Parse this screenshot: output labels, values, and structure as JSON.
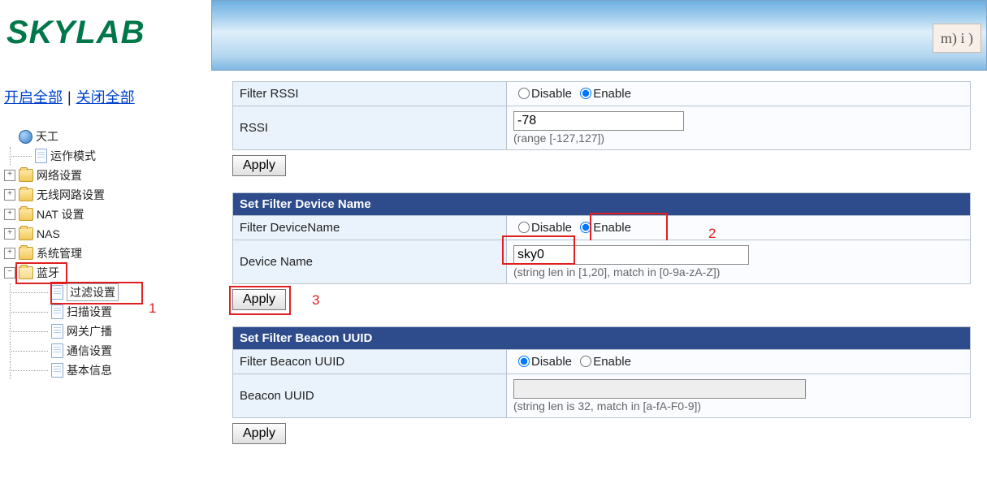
{
  "brand": "SKYLAB",
  "bannerIcon": "m) i )",
  "links": {
    "openAll": "开启全部",
    "closeAll": "关闭全部"
  },
  "tree": {
    "root": "天工",
    "items": {
      "opMode": "运作模式",
      "network": "网络设置",
      "wireless": "无线网路设置",
      "nat": "NAT 设置",
      "nas": "NAS",
      "sysMgmt": "系统管理",
      "bluetooth": "蓝牙",
      "btFilter": "过滤设置",
      "btScan": "扫描设置",
      "btGateway": "网关广播",
      "btComm": "通信设置",
      "btInfo": "基本信息"
    }
  },
  "rssi": {
    "filterLabel": "Filter RSSI",
    "valueLabel": "RSSI",
    "disable": "Disable",
    "enable": "Enable",
    "selected": "enable",
    "value": "-78",
    "hint": "(range [-127,127])",
    "apply": "Apply"
  },
  "devName": {
    "header": "Set Filter Device Name",
    "filterLabel": "Filter DeviceName",
    "valueLabel": "Device Name",
    "disable": "Disable",
    "enable": "Enable",
    "selected": "enable",
    "value": "sky0",
    "hint": "(string len in [1,20], match in [0-9a-zA-Z])",
    "apply": "Apply"
  },
  "uuid": {
    "header": "Set Filter Beacon UUID",
    "filterLabel": "Filter Beacon UUID",
    "valueLabel": "Beacon UUID",
    "disable": "Disable",
    "enable": "Enable",
    "selected": "disable",
    "value": "",
    "hint": "(string len is 32, match in [a-fA-F0-9])",
    "apply": "Apply"
  },
  "ann": {
    "a1": "1",
    "a2": "2",
    "a3": "3"
  }
}
